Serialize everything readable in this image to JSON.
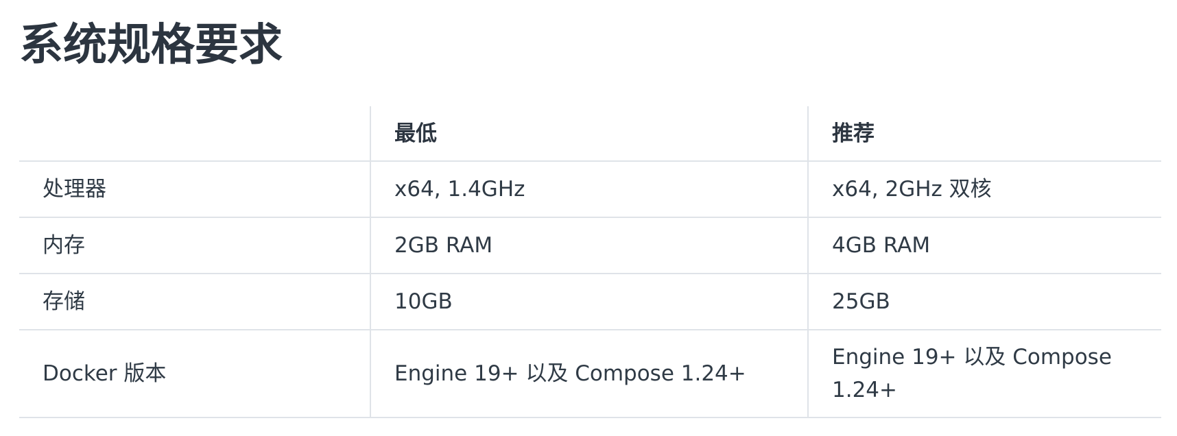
{
  "title": "系统规格要求",
  "table": {
    "headers": [
      "",
      "最低",
      "推荐"
    ],
    "rows": [
      {
        "label": "处理器",
        "minimum": "x64, 1.4GHz",
        "recommended": "x64, 2GHz 双核"
      },
      {
        "label": "内存",
        "minimum": "2GB RAM",
        "recommended": "4GB RAM"
      },
      {
        "label": "存储",
        "minimum": "10GB",
        "recommended": "25GB"
      },
      {
        "label": "Docker 版本",
        "minimum": "Engine 19+ 以及 Compose 1.24+",
        "recommended": "Engine 19+ 以及 Compose 1.24+"
      }
    ]
  }
}
